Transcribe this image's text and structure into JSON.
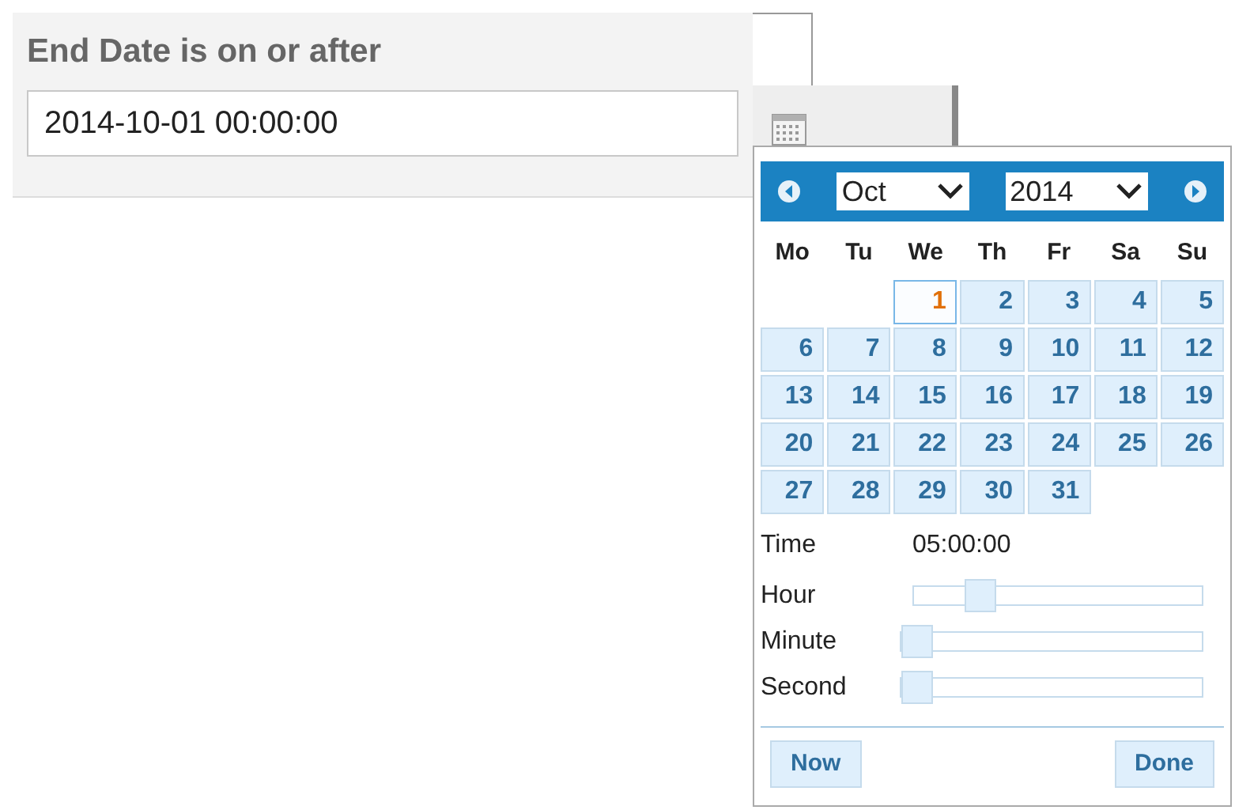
{
  "filter": {
    "label": "End Date is on or after",
    "value": "2014-10-01 00:00:00"
  },
  "datepicker": {
    "month": "Oct",
    "year": "2014",
    "weekdays": [
      "Mo",
      "Tu",
      "We",
      "Th",
      "Fr",
      "Sa",
      "Su"
    ],
    "weeks": [
      [
        {
          "label": "1",
          "selected": true
        },
        {
          "label": "2",
          "selected": false
        },
        {
          "label": "3",
          "selected": false
        },
        {
          "label": "4",
          "selected": false
        },
        {
          "label": "5",
          "selected": false
        }
      ],
      [
        {
          "label": "6",
          "selected": false
        },
        {
          "label": "7",
          "selected": false
        },
        {
          "label": "8",
          "selected": false
        },
        {
          "label": "9",
          "selected": false
        },
        {
          "label": "10",
          "selected": false
        },
        {
          "label": "11",
          "selected": false
        },
        {
          "label": "12",
          "selected": false
        }
      ],
      [
        {
          "label": "13",
          "selected": false
        },
        {
          "label": "14",
          "selected": false
        },
        {
          "label": "15",
          "selected": false
        },
        {
          "label": "16",
          "selected": false
        },
        {
          "label": "17",
          "selected": false
        },
        {
          "label": "18",
          "selected": false
        },
        {
          "label": "19",
          "selected": false
        }
      ],
      [
        {
          "label": "20",
          "selected": false
        },
        {
          "label": "21",
          "selected": false
        },
        {
          "label": "22",
          "selected": false
        },
        {
          "label": "23",
          "selected": false
        },
        {
          "label": "24",
          "selected": false
        },
        {
          "label": "25",
          "selected": false
        },
        {
          "label": "26",
          "selected": false
        }
      ],
      [
        {
          "label": "27",
          "selected": false
        },
        {
          "label": "28",
          "selected": false
        },
        {
          "label": "29",
          "selected": false
        },
        {
          "label": "30",
          "selected": false
        },
        {
          "label": "31",
          "selected": false
        }
      ]
    ],
    "time_label": "Time",
    "time_value": "05:00:00",
    "sliders": [
      {
        "label": "Hour",
        "level": 0.2
      },
      {
        "label": "Minute",
        "level": 0
      },
      {
        "label": "Second",
        "level": 0
      }
    ],
    "buttons": [
      "Now",
      "Done"
    ]
  }
}
